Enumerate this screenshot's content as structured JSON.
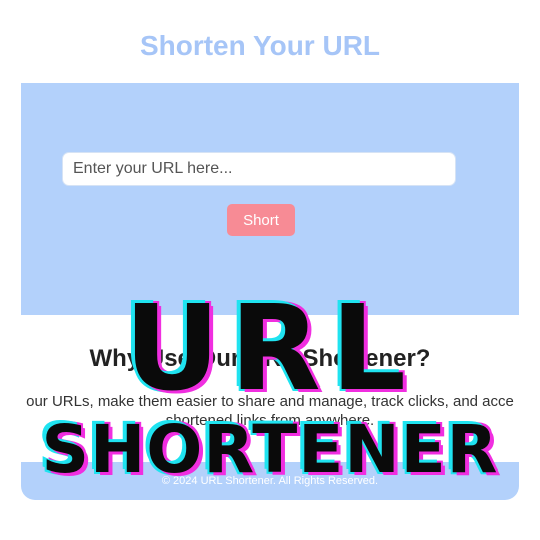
{
  "header": {
    "title": "Shorten Your URL"
  },
  "form": {
    "url_placeholder": "Enter your URL here...",
    "url_value": "",
    "submit_label": "Short"
  },
  "why_section": {
    "heading": "Why Use Our URL Shortener?",
    "text_line_1": "our URLs, make them easier to share and manage, track clicks, and acce",
    "text_line_2": "shortened links from anywhere."
  },
  "footer": {
    "text": "© 2024 URL Shortener. All Rights Reserved."
  },
  "overlay": {
    "line_1": "URL",
    "line_2": "SHORTENER"
  },
  "colors": {
    "title": "#a6c5f7",
    "panel": "#b3d1fb",
    "button": "#f78b95",
    "overlay_cyan": "#1fe3f0",
    "overlay_magenta": "#f02ee0"
  }
}
